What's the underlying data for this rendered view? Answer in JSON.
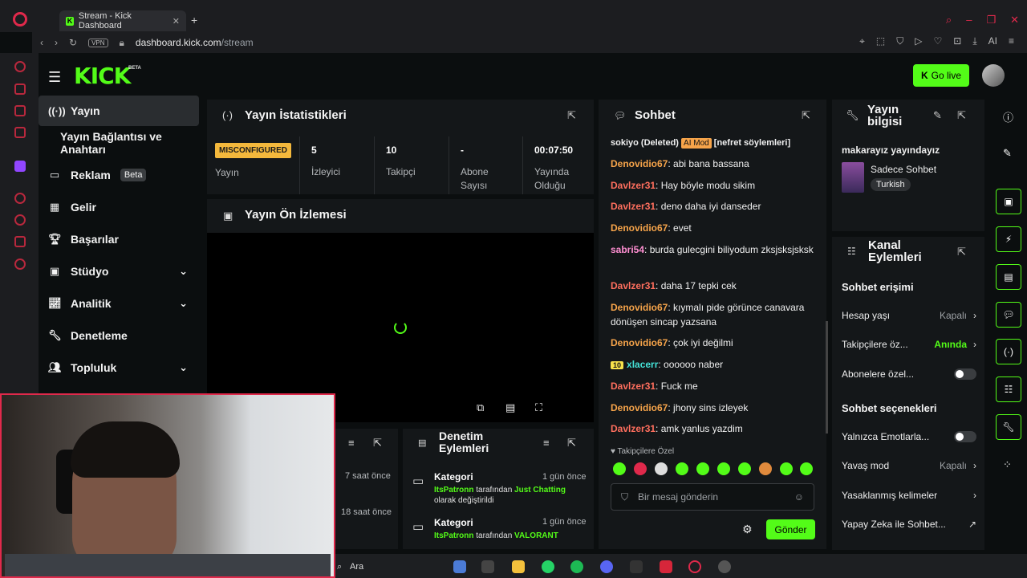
{
  "browser": {
    "tab_title": "Stream - Kick Dashboard",
    "url_domain": "dashboard.kick.com",
    "url_path": "/stream",
    "vpn": "VPN",
    "ai": "AI"
  },
  "header": {
    "logo": "KICK",
    "beta": "BETA",
    "go_live": "Go live"
  },
  "nav": [
    {
      "label": "Yayın"
    },
    {
      "label": "Yayın Bağlantısı ve Anahtarı"
    },
    {
      "label": "Reklam",
      "badge": "Beta"
    },
    {
      "label": "Gelir"
    },
    {
      "label": "Başarılar"
    },
    {
      "label": "Stüdyo"
    },
    {
      "label": "Analitik"
    },
    {
      "label": "Denetleme"
    },
    {
      "label": "Topluluk"
    }
  ],
  "stats": {
    "title": "Yayın İstatistikleri",
    "status": "MISCONFIGURED",
    "status_label": "Yayın",
    "viewers": "5",
    "viewers_label": "İzleyici",
    "followers": "10",
    "followers_label": "Takipçi",
    "subs": "-",
    "subs_label": "Abone Sayısı",
    "uptime": "00:07:50",
    "uptime_label": "Yayında Olduğu"
  },
  "preview": {
    "title": "Yayın Ön İzlemesi"
  },
  "chat": {
    "title": "Sohbet",
    "top_user": "sokiyo (Deleted)",
    "top_badge": "AI Mod",
    "top_msg": "[nefret söylemleri]",
    "messages": [
      {
        "user": "Denovidio67",
        "text": ": abi bana bassana"
      },
      {
        "user": "Davlzer31",
        "text": ": Hay böyle modu sikim"
      },
      {
        "user": "Davlzer31",
        "text": ": deno daha iyi danseder"
      },
      {
        "user": "Denovidio67",
        "text": ": evet"
      },
      {
        "user": "sabri54",
        "text": ": burda gulecgini biliyodum zksjsksjsksk"
      },
      {
        "user": "Davlzer31",
        "text": ": daha 17 tepki cek"
      },
      {
        "user": "Denovidio67",
        "text": ": kıymalı pide görünce canavara dönüşen sincap yazsana"
      },
      {
        "user": "Denovidio67",
        "text": ": çok iyi değilmi"
      },
      {
        "user": "xlacerr",
        "badge": "10",
        "text": ": oooooo naber"
      },
      {
        "user": "Davlzer31",
        "text": ": Fuck me"
      },
      {
        "user": "Denovidio67",
        "text": ": jhony sins izleyek"
      },
      {
        "user": "Davlzer31",
        "text": ": amk yanlus yazdim"
      }
    ],
    "followers_only": "Takipçilere Özel",
    "placeholder": "Bir mesaj gönderin",
    "send": "Gönder"
  },
  "stream_info": {
    "title": "Yayın bilgisi",
    "stream_title": "makarayız yayındayız",
    "category": "Sadece Sohbet",
    "language": "Turkish"
  },
  "channel_actions": {
    "title": "Kanal Eylemleri",
    "chat_access": "Sohbet erişimi",
    "rows_access": [
      {
        "label": "Hesap yaşı",
        "value": "Kapalı"
      },
      {
        "label": "Takipçilere öz...",
        "value": "Anında"
      },
      {
        "label": "Abonelere özel..."
      }
    ],
    "chat_options": "Sohbet seçenekleri",
    "rows_options": [
      {
        "label": "Yalnızca Emotlarla..."
      },
      {
        "label": "Yavaş mod",
        "value": "Kapalı"
      },
      {
        "label": "Yasaklanmış kelimeler"
      },
      {
        "label": "Yapay Zeka ile Sohbet..."
      }
    ]
  },
  "moderation": {
    "title": "Denetim Eylemleri",
    "items": [
      {
        "title": "Kategori",
        "time": "1 gün önce",
        "user": "ItsPatronn",
        "mid": " tarafından ",
        "target": "Just Chatting",
        "rest": "olarak değiştirildi"
      },
      {
        "title": "Kategori",
        "time": "1 gün önce",
        "user": "ItsPatronn",
        "mid": " tarafından ",
        "target": "VALORANT",
        "rest": ""
      }
    ]
  },
  "events": {
    "times": [
      "7 saat önce",
      "18 saat önce"
    ]
  },
  "taskbar": {
    "search": "Ara"
  }
}
